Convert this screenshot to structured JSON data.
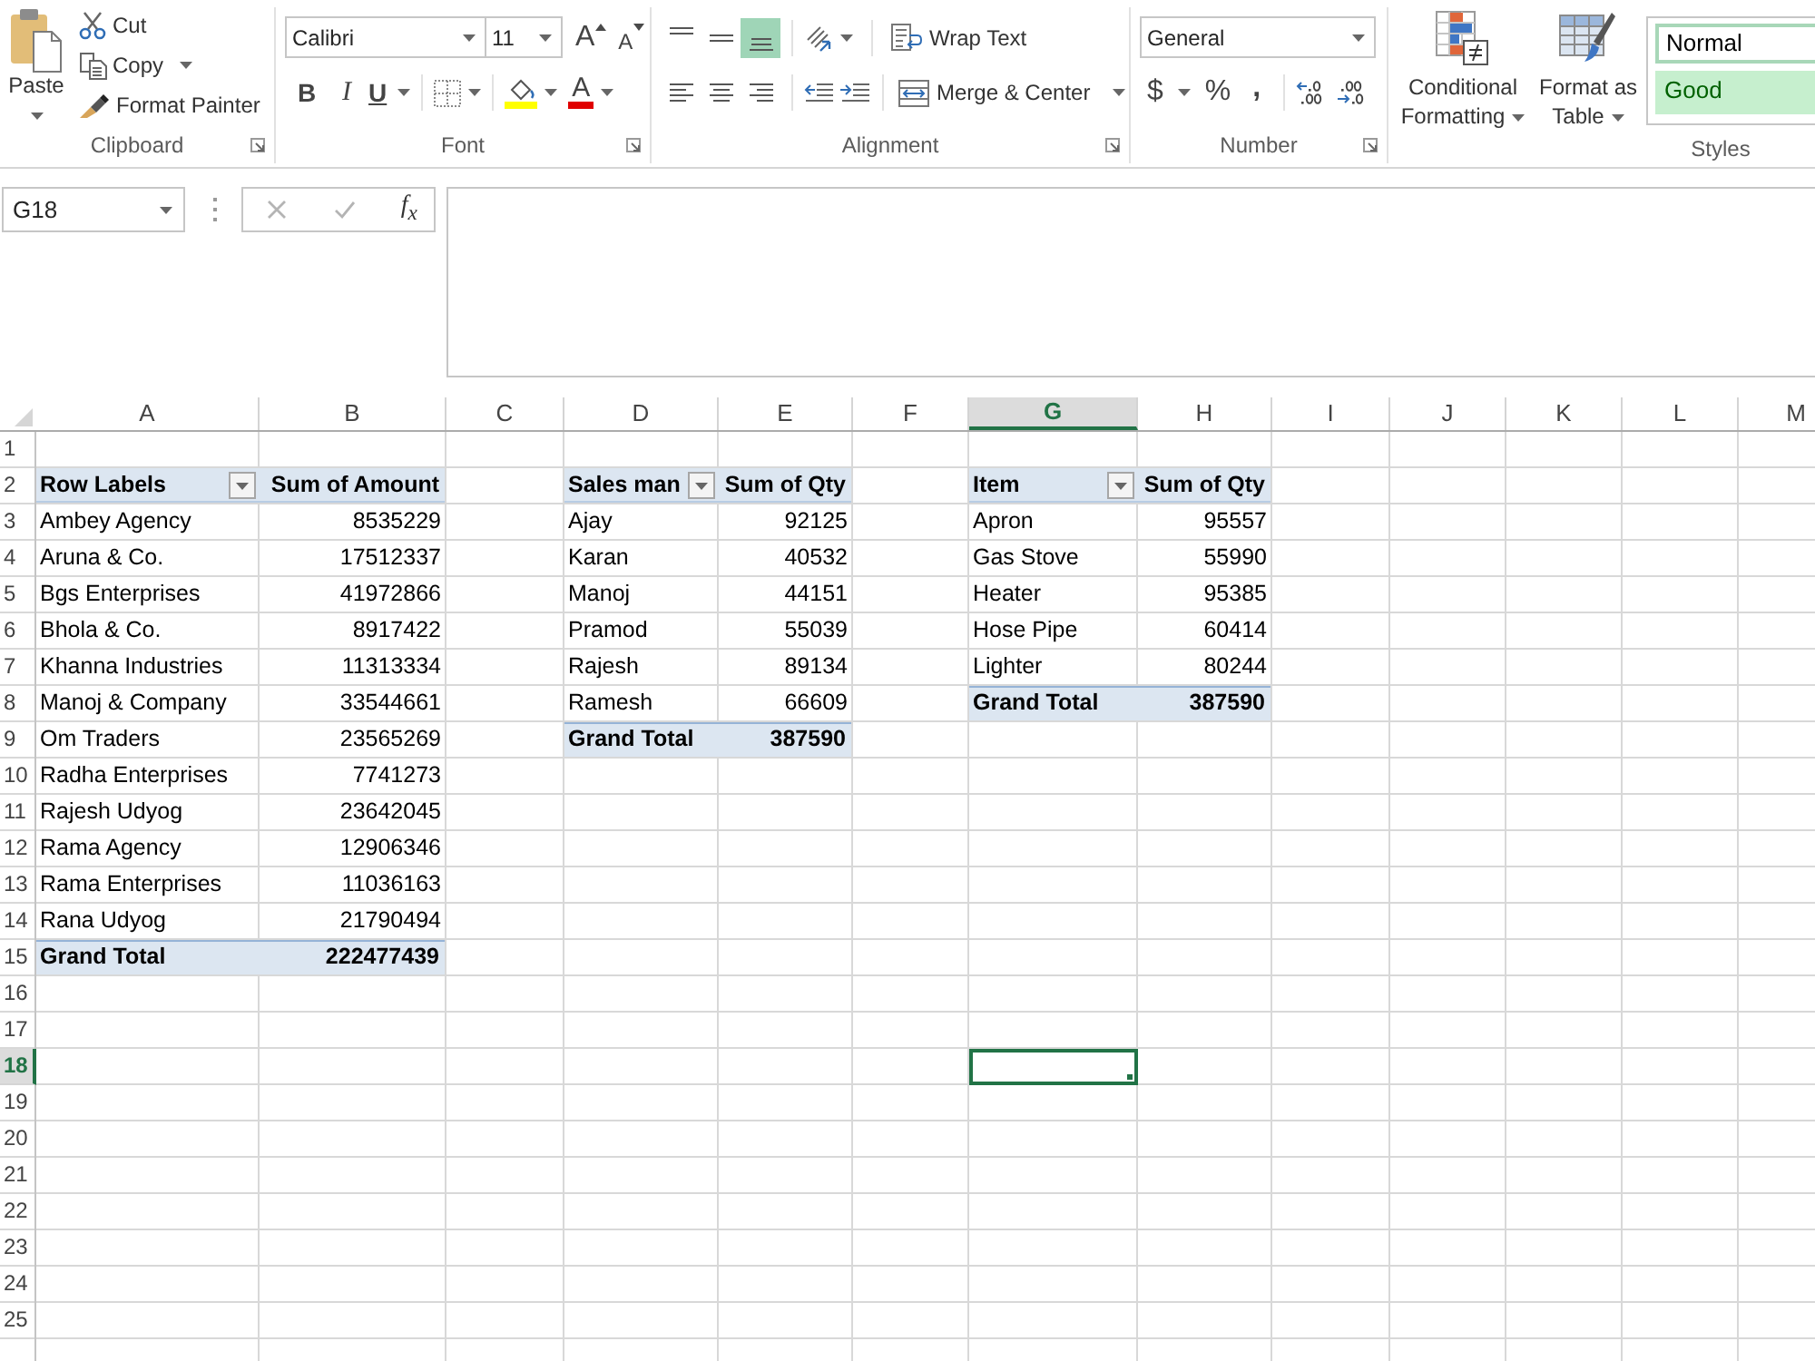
{
  "ribbon": {
    "clipboard": {
      "paste": "Paste",
      "cut": "Cut",
      "copy": "Copy",
      "format_painter": "Format Painter",
      "label": "Clipboard"
    },
    "font": {
      "font_name": "Calibri",
      "font_size": "11",
      "grow_font": "A",
      "shrink_font": "A",
      "bold": "B",
      "italic": "I",
      "underline": "U",
      "font_color": "A",
      "label": "Font"
    },
    "alignment": {
      "vertical": [
        {
          "kind": "top",
          "selected": false
        },
        {
          "kind": "middle",
          "selected": false
        },
        {
          "kind": "bottom",
          "selected": true
        }
      ],
      "horizontal": [
        {
          "kind": "left",
          "selected": false
        },
        {
          "kind": "center",
          "selected": false
        },
        {
          "kind": "right",
          "selected": false
        }
      ],
      "wrap_text": "Wrap Text",
      "merge_center": "Merge & Center",
      "label": "Alignment"
    },
    "number": {
      "format": "General",
      "currency": "$",
      "percent": "%",
      "comma": ",",
      "label": "Number"
    },
    "styles": {
      "conditional_formatting": "Conditional Formatting",
      "format_as_table": "Format as Table",
      "cell_styles": [
        {
          "kind": "normal",
          "name": "Normal",
          "selected": true
        },
        {
          "kind": "good",
          "name": "Good",
          "selected": false
        }
      ],
      "label": "Styles"
    }
  },
  "formula_bar": {
    "name_box": "G18",
    "buttons": [
      {
        "kind": "cancel",
        "disabled": true
      },
      {
        "kind": "enter",
        "disabled": true
      }
    ],
    "insert_function": "f$_{x}$"
  },
  "grid": {
    "columns": [
      {
        "label": "A",
        "selected": false
      },
      {
        "label": "B",
        "selected": false
      },
      {
        "label": "C",
        "selected": false
      },
      {
        "label": "D",
        "selected": false
      },
      {
        "label": "E",
        "selected": false
      },
      {
        "label": "F",
        "selected": false
      },
      {
        "label": "G",
        "selected": true
      },
      {
        "label": "H",
        "selected": false
      },
      {
        "label": "I",
        "selected": false
      },
      {
        "label": "J",
        "selected": false
      },
      {
        "label": "K",
        "selected": false
      },
      {
        "label": "L",
        "selected": false
      },
      {
        "label": "M",
        "selected": false
      }
    ],
    "rows": [
      {
        "label": "1",
        "selected": false
      },
      {
        "label": "2",
        "selected": false
      },
      {
        "label": "3",
        "selected": false
      },
      {
        "label": "4",
        "selected": false
      },
      {
        "label": "5",
        "selected": false
      },
      {
        "label": "6",
        "selected": false
      },
      {
        "label": "7",
        "selected": false
      },
      {
        "label": "8",
        "selected": false
      },
      {
        "label": "9",
        "selected": false
      },
      {
        "label": "10",
        "selected": false
      },
      {
        "label": "11",
        "selected": false
      },
      {
        "label": "12",
        "selected": false
      },
      {
        "label": "13",
        "selected": false
      },
      {
        "label": "14",
        "selected": false
      },
      {
        "label": "15",
        "selected": false
      },
      {
        "label": "16",
        "selected": false
      },
      {
        "label": "17",
        "selected": false
      },
      {
        "label": "18",
        "selected": true
      },
      {
        "label": "19",
        "selected": false
      },
      {
        "label": "20",
        "selected": false
      },
      {
        "label": "21",
        "selected": false
      },
      {
        "label": "22",
        "selected": false
      },
      {
        "label": "23",
        "selected": false
      },
      {
        "label": "24",
        "selected": false
      },
      {
        "label": "25",
        "selected": false
      }
    ],
    "pivot_tables": [
      {
        "header": [
          "Row Labels",
          "Sum of Amount"
        ],
        "rows": [
          [
            "Ambey Agency",
            "8535229"
          ],
          [
            "Aruna & Co.",
            "17512337"
          ],
          [
            "Bgs Enterprises",
            "41972866"
          ],
          [
            "Bhola & Co.",
            "8917422"
          ],
          [
            "Khanna Industries",
            "11313334"
          ],
          [
            "Manoj & Company",
            "33544661"
          ],
          [
            "Om Traders",
            "23565269"
          ],
          [
            "Radha Enterprises",
            "7741273"
          ],
          [
            "Rajesh Udyog",
            "23642045"
          ],
          [
            "Rama Agency",
            "12906346"
          ],
          [
            "Rama Enterprises",
            "11036163"
          ],
          [
            "Rana Udyog",
            "21790494"
          ]
        ],
        "total": [
          "Grand Total",
          "222477439"
        ]
      },
      {
        "header": [
          "Sales man",
          "Sum of Qty"
        ],
        "rows": [
          [
            "Ajay",
            "92125"
          ],
          [
            "Karan",
            "40532"
          ],
          [
            "Manoj",
            "44151"
          ],
          [
            "Pramod",
            "55039"
          ],
          [
            "Rajesh",
            "89134"
          ],
          [
            "Ramesh",
            "66609"
          ]
        ],
        "total": [
          "Grand Total",
          "387590"
        ]
      },
      {
        "header": [
          "Item",
          "Sum of Qty"
        ],
        "rows": [
          [
            "Apron",
            "95557"
          ],
          [
            "Gas Stove",
            "55990"
          ],
          [
            "Heater",
            "95385"
          ],
          [
            "Hose Pipe",
            "60414"
          ],
          [
            "Lighter",
            "80244"
          ]
        ],
        "total": [
          "Grand Total",
          "387590"
        ]
      }
    ]
  }
}
